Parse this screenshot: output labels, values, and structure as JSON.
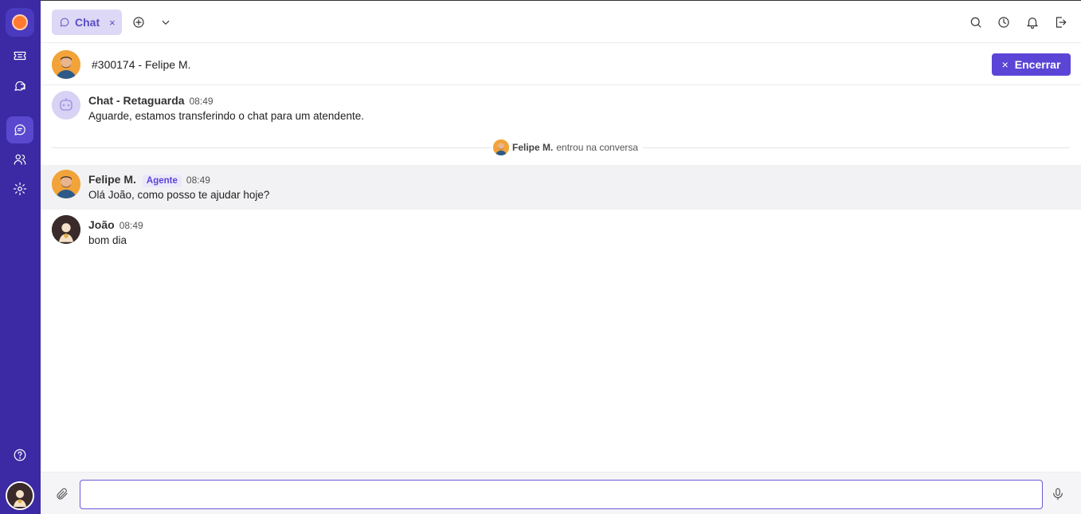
{
  "tab": {
    "label": "Chat",
    "close": "×"
  },
  "header": {
    "title": "#300174 - Felipe M.",
    "end_label": "Encerrar",
    "end_icon": "×"
  },
  "messages": [
    {
      "name": "Chat - Retaguarda",
      "time": "08:49",
      "text": "Aguarde, estamos transferindo o chat para um atendente."
    },
    {
      "name": "Felipe M.",
      "badge": "Agente",
      "time": "08:49",
      "text": "Olá João, como posso te ajudar hoje?"
    },
    {
      "name": "João",
      "time": "08:49",
      "text": "bom dia"
    }
  ],
  "system_event": {
    "name": "Felipe M.",
    "text": "entrou na conversa"
  },
  "composer": {
    "value": "",
    "placeholder": ""
  },
  "colors": {
    "sidebar": "#3b2aa3",
    "accent": "#5b45d6",
    "tab_bg": "#dcd8f6",
    "highlight_row": "#f2f2f4"
  }
}
